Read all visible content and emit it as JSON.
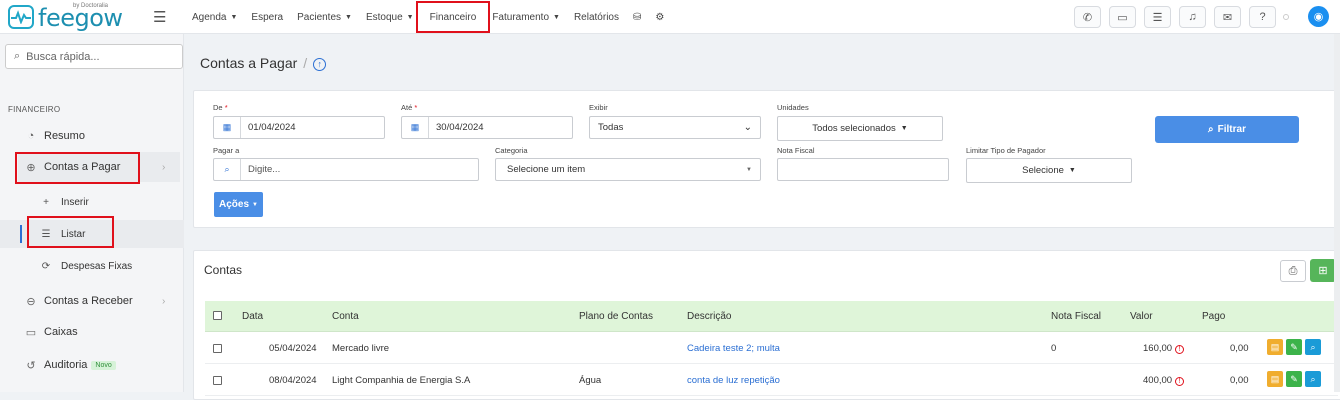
{
  "brand": {
    "name": "feegow",
    "by": "by Doctoralia"
  },
  "menu": [
    {
      "label": "Agenda",
      "caret": true
    },
    {
      "label": "Espera",
      "caret": false
    },
    {
      "label": "Pacientes",
      "caret": true
    },
    {
      "label": "Estoque",
      "caret": true
    },
    {
      "label": "Financeiro",
      "caret": false,
      "highlight": true
    },
    {
      "label": "Faturamento",
      "caret": true
    },
    {
      "label": "Relatórios",
      "caret": false
    }
  ],
  "search": {
    "placeholder": "Busca rápida..."
  },
  "sidebar": {
    "section": "FINANCEIRO",
    "resumo": "Resumo",
    "contas_pagar": "Contas a Pagar",
    "inserir": "Inserir",
    "listar": "Listar",
    "despesas": "Despesas Fixas",
    "contas_receber": "Contas a Receber",
    "caixas": "Caixas",
    "auditoria": "Auditoria",
    "novo": "Novo"
  },
  "page": {
    "title": "Contas a Pagar",
    "sep": "/"
  },
  "filters": {
    "de_label": "De",
    "de_value": "01/04/2024",
    "req": "*",
    "ate_label": "Até",
    "ate_value": "30/04/2024",
    "exibir_label": "Exibir",
    "exibir_value": "Todas",
    "unidades_label": "Unidades",
    "unidades_value": "Todos selecionados",
    "pagar_label": "Pagar a",
    "pagar_placeholder": "Digite...",
    "categoria_label": "Categoria",
    "categoria_value": "Selecione um item",
    "nf_label": "Nota Fiscal",
    "limitar_label": "Limitar Tipo de Pagador",
    "limitar_value": "Selecione",
    "filtrar": "Filtrar",
    "acoes": "Ações"
  },
  "table": {
    "title": "Contas",
    "headers": {
      "data": "Data",
      "conta": "Conta",
      "plano": "Plano de Contas",
      "descricao": "Descrição",
      "nf": "Nota Fiscal",
      "valor": "Valor",
      "pago": "Pago"
    },
    "rows": [
      {
        "data": "05/04/2024",
        "conta": "Mercado livre",
        "plano": "",
        "descricao": "Cadeira teste 2; multa",
        "nf": "0",
        "valor": "160,00",
        "pago": "0,00"
      },
      {
        "data": "08/04/2024",
        "conta": "Light Companhia de Energia S.A",
        "plano": "Água",
        "descricao": "conta de luz repetição",
        "nf": "",
        "valor": "400,00",
        "pago": "0,00"
      }
    ]
  }
}
